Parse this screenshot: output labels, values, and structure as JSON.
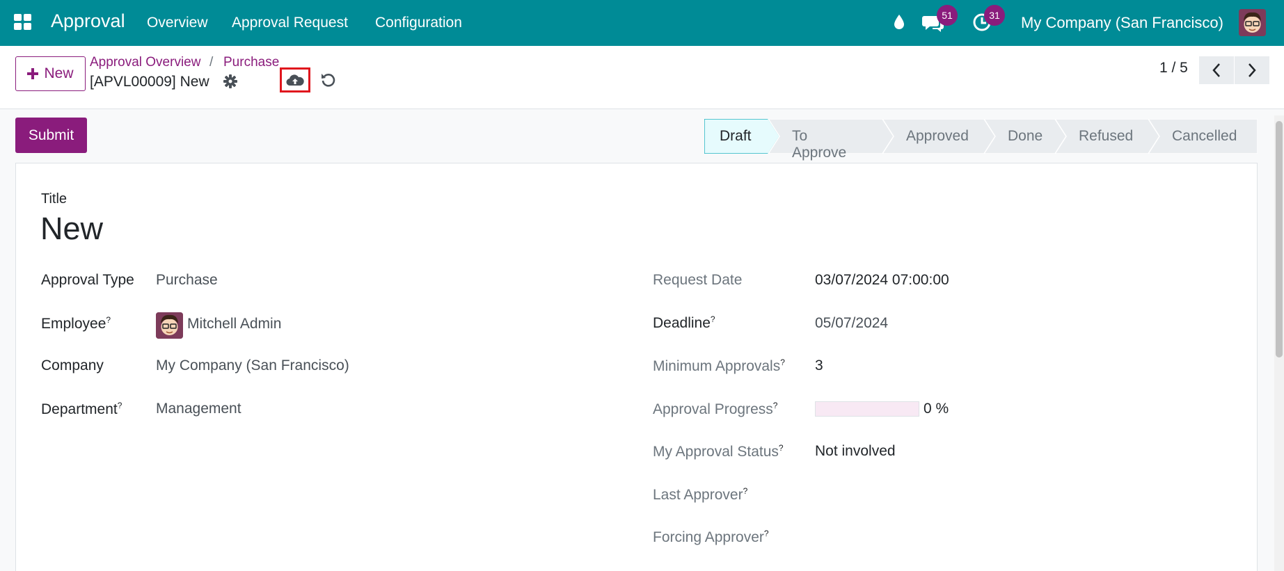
{
  "navbar": {
    "app_title": "Approval",
    "menu": [
      "Overview",
      "Approval Request",
      "Configuration"
    ],
    "messages_count": "51",
    "activities_count": "31",
    "company": "My Company (San Francisco)",
    "bg_color": "#008b96"
  },
  "control": {
    "new_label": "New",
    "breadcrumb": [
      "Approval Overview",
      "Purchase"
    ],
    "breadcrumb_sep": "/",
    "record_name": "[APVL00009] New",
    "pager": "1 / 5"
  },
  "actions": {
    "submit_label": "Submit"
  },
  "statusbar": {
    "stages": [
      "Draft",
      "To Approve",
      "Approved",
      "Done",
      "Refused",
      "Cancelled"
    ],
    "active": "Draft"
  },
  "form": {
    "title_label": "Title",
    "title_value": "New",
    "left": [
      {
        "label": "Approval Type",
        "help": "",
        "value": "Purchase"
      },
      {
        "label": "Employee",
        "help": "?",
        "value": "Mitchell Admin"
      },
      {
        "label": "Company",
        "help": "",
        "value": "My Company (San Francisco)"
      },
      {
        "label": "Department",
        "help": "?",
        "value": "Management"
      }
    ],
    "right": [
      {
        "label": "Request Date",
        "help": "",
        "value": "03/07/2024 07:00:00"
      },
      {
        "label": "Deadline",
        "help": "?",
        "value": "05/07/2024"
      },
      {
        "label": "Minimum Approvals",
        "help": "?",
        "value": "3"
      },
      {
        "label": "Approval Progress",
        "help": "?",
        "value": "0 %"
      },
      {
        "label": "My Approval Status",
        "help": "?",
        "value": "Not involved"
      },
      {
        "label": "Last Approver",
        "help": "?",
        "value": ""
      },
      {
        "label": "Forcing Approver",
        "help": "?",
        "value": ""
      }
    ],
    "approval_progress_fraction": 0
  },
  "colors": {
    "primary": "#8a1c7c",
    "navbar": "#008b96",
    "save_highlight": "#e0161d"
  }
}
